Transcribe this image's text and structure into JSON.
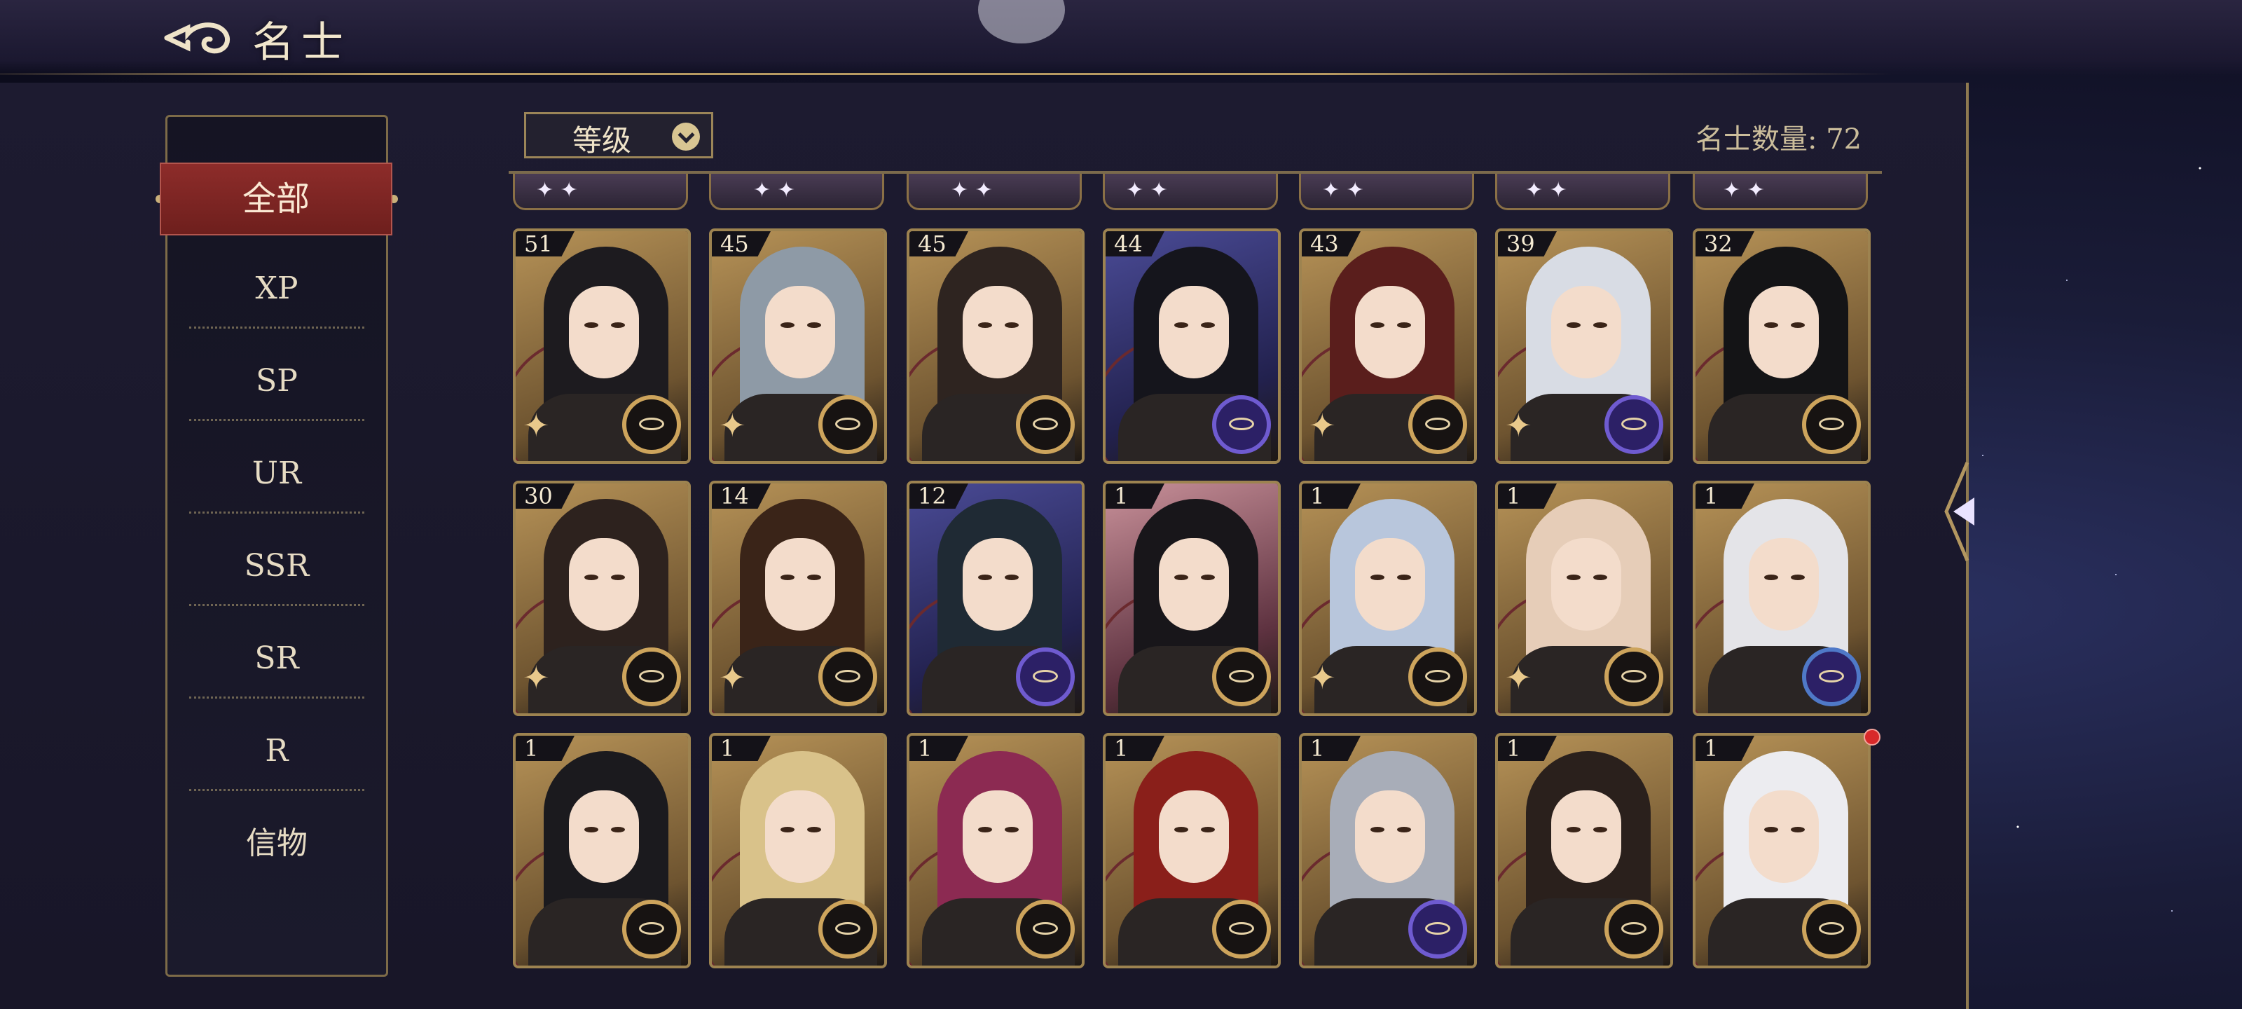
{
  "header": {
    "title": "名士",
    "back_icon": "cloud-back-icon"
  },
  "sidebar": {
    "active": "全部",
    "items": [
      "XP",
      "SP",
      "UR",
      "SSR",
      "SR",
      "R",
      "信物"
    ]
  },
  "filter": {
    "selected": "等级",
    "icon": "chevron-down-icon"
  },
  "count": "名士数量: 72",
  "colors": {
    "accent": "#9d8350",
    "active_tab": "#8d2c2a",
    "notify": "#d8292a"
  },
  "cards": {
    "row1": [
      {
        "level": "51",
        "tone": "gold",
        "emblem": "compass"
      },
      {
        "level": "45",
        "tone": "gold",
        "emblem": "compass"
      },
      {
        "level": "45",
        "tone": "gold",
        "emblem": "compass"
      },
      {
        "level": "44",
        "tone": "violet",
        "emblem": "orb"
      },
      {
        "level": "43",
        "tone": "gold",
        "emblem": "compass"
      },
      {
        "level": "39",
        "tone": "gold",
        "emblem": "planet"
      },
      {
        "level": "32",
        "tone": "gold",
        "emblem": "compass"
      }
    ],
    "row2": [
      {
        "level": "30",
        "tone": "gold",
        "emblem": "compass"
      },
      {
        "level": "14",
        "tone": "gold",
        "emblem": "compass"
      },
      {
        "level": "12",
        "tone": "violet",
        "emblem": "planet"
      },
      {
        "level": "1",
        "tone": "rose",
        "emblem": "compass"
      },
      {
        "level": "1",
        "tone": "gold",
        "emblem": "compass"
      },
      {
        "level": "1",
        "tone": "gold",
        "emblem": "compass"
      },
      {
        "level": "1",
        "tone": "gold",
        "emblem": "blue-gem"
      }
    ],
    "row3": [
      {
        "level": "1",
        "tone": "gold",
        "emblem": "compass"
      },
      {
        "level": "1",
        "tone": "gold",
        "emblem": "compass"
      },
      {
        "level": "1",
        "tone": "gold",
        "emblem": "compass"
      },
      {
        "level": "1",
        "tone": "gold",
        "emblem": "compass"
      },
      {
        "level": "1",
        "tone": "gold",
        "emblem": "planet"
      },
      {
        "level": "1",
        "tone": "gold",
        "emblem": "compass"
      },
      {
        "level": "1",
        "tone": "gold",
        "emblem": "compass"
      }
    ]
  }
}
